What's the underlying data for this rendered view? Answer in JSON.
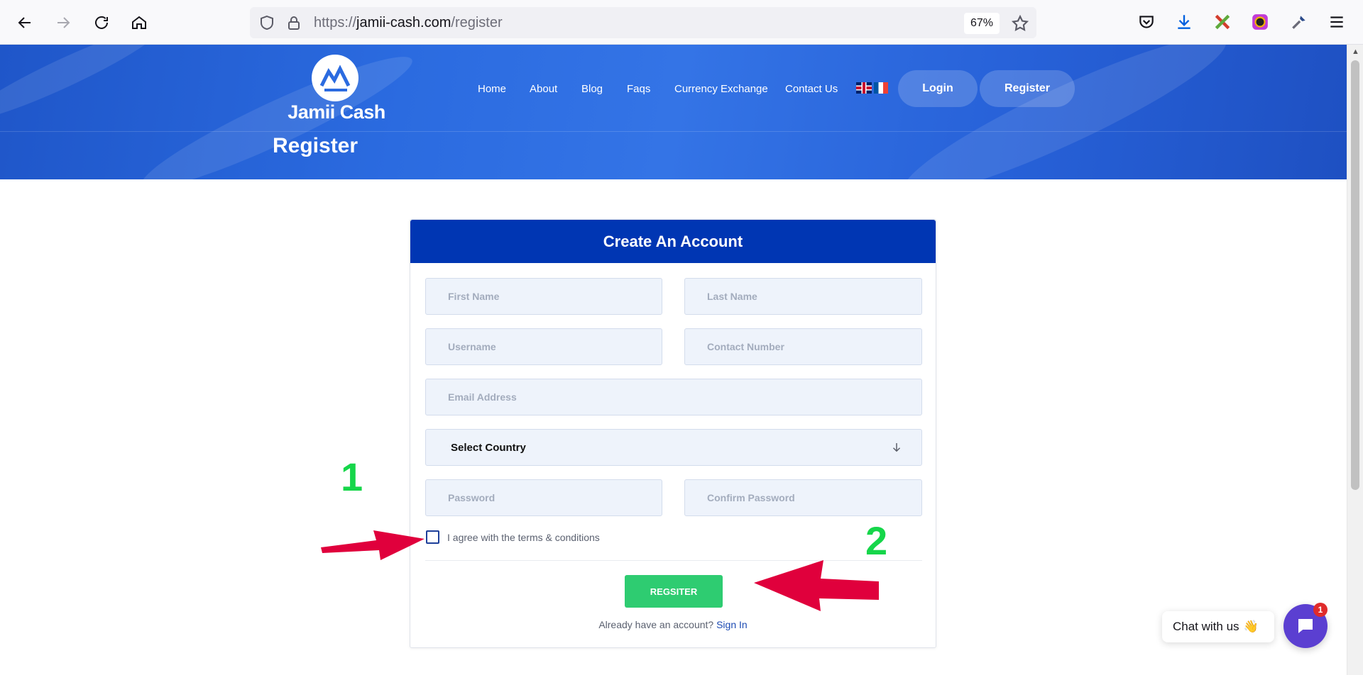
{
  "browser": {
    "url_prefix": "https://",
    "url_host": "jamii-cash.com",
    "url_path": "/register",
    "zoom": "67%"
  },
  "site": {
    "logo_text": "Jamii Cash",
    "nav": [
      "Home",
      "About",
      "Blog",
      "Faqs",
      "Currency Exchange",
      "Contact Us"
    ],
    "login_label": "Login",
    "register_label": "Register",
    "page_title": "Register"
  },
  "form": {
    "heading": "Create An Account",
    "first_name_placeholder": "First Name",
    "last_name_placeholder": "Last Name",
    "username_placeholder": "Username",
    "contact_placeholder": "Contact Number",
    "email_placeholder": "Email Address",
    "country_label": "Select Country",
    "password_placeholder": "Password",
    "confirm_password_placeholder": "Confirm Password",
    "terms_label": "I agree with the terms & conditions",
    "submit_label": "REGSITER",
    "signin_prompt": "Already have an account?",
    "signin_link": "Sign In"
  },
  "annotations": {
    "step_1": "1",
    "step_2": "2"
  },
  "chat": {
    "label": "Chat with us",
    "badge_count": "1"
  },
  "colors": {
    "hero_blue": "#2b6be0",
    "card_header": "#0036b3",
    "submit_green": "#2ecc71",
    "annotation_green": "#16d64a",
    "arrow_red": "#e0003c",
    "chat_purple": "#5b3fd1"
  }
}
